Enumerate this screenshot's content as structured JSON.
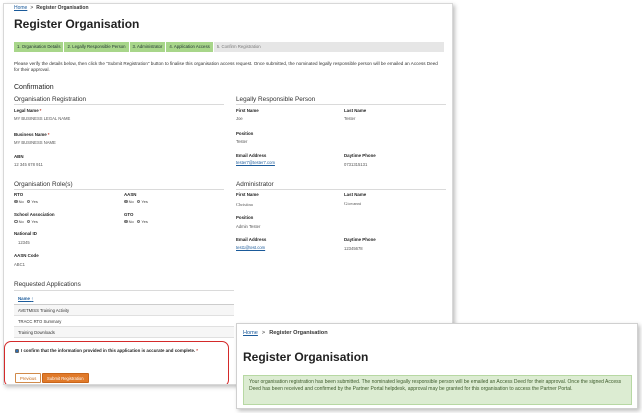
{
  "form": {
    "breadcrumb": {
      "home": "Home",
      "separator": ">",
      "current": "Register Organisation"
    },
    "title": "Register Organisation",
    "steps": [
      {
        "label": "1. Organisation Details",
        "state": "done"
      },
      {
        "label": "2. Legally Responsible Person",
        "state": "done"
      },
      {
        "label": "3. Administrator",
        "state": "done"
      },
      {
        "label": "4. Application Access",
        "state": "done"
      },
      {
        "label": "5. Confirm Registration",
        "state": "active"
      }
    ],
    "intro": "Please verify the details below, then click the \"Submit Registration\" button to finalise this organisation access request. Once submitted, the nominated legally responsible person will be emailed an Access Deed for their approval.",
    "confirmation_heading": "Confirmation",
    "org_registration": {
      "title": "Organisation Registration",
      "legal_name_label": "Legal Name",
      "legal_name_value": "MY BUSINESS LEGAL NAME",
      "business_name_label": "Business Name",
      "business_name_value": "MY BUSINESS NAME",
      "abn_label": "ABN",
      "abn_value": "12 345 678 911"
    },
    "lrp": {
      "title": "Legally Responsible Person",
      "first_name_label": "First Name",
      "first_name_value": "Joe",
      "last_name_label": "Last Name",
      "last_name_value": "Tester",
      "position_label": "Position",
      "position_value": "Tester",
      "email_label": "Email Address",
      "email_value": "tester7@tester7.com",
      "phone_label": "Daytime Phone",
      "phone_value": "0731315131"
    },
    "org_roles": {
      "title": "Organisation Role(s)",
      "rto_label": "RTO",
      "aasn_label": "AASN",
      "school_label": "School Association",
      "gto_label": "GTO",
      "no_label": "No",
      "yes_label": "Yes",
      "national_id_label": "National ID",
      "national_id_value": "12345",
      "aasn_code_label": "AASN Code",
      "aasn_code_value": "ABC1",
      "selections": {
        "rto": "no",
        "aasn": "no",
        "school": "yes",
        "gto": "no"
      }
    },
    "administrator": {
      "title": "Administrator",
      "first_name_label": "First Name",
      "first_name_value": "Christina",
      "last_name_label": "Last Name",
      "last_name_value": "Giovanni",
      "position_label": "Position",
      "position_value": "Admin Tester",
      "email_label": "Email Address",
      "email_value": "test1@test.com",
      "phone_label": "Daytime Phone",
      "phone_value": "12345678"
    },
    "requested_apps": {
      "title": "Requested Applications",
      "column_header": "Name",
      "sort_glyph": "↑",
      "rows": [
        "AVETMISS Training Activity",
        "TRACC RTO Summary",
        "Training Downloads"
      ]
    },
    "confirm": {
      "text": "I confirm that the information provided in this application is accurate and complete.",
      "required_mark": "*"
    },
    "buttons": {
      "previous": "Previous",
      "submit": "Submit Registration"
    }
  },
  "success_page": {
    "breadcrumb": {
      "home": "Home",
      "separator": ">",
      "current": "Register Organisation"
    },
    "title": "Register Organisation",
    "message": "Your organisation registration has been submitted. The nominated legally responsible person will be emailed an Access Deed for their approval. Once the signed Access Deed has been received and confirmed by the Partner Portal helpdesk, approval may be granted for this organisation to access the Partner Portal."
  },
  "colors": {
    "step_done": "#a8d68a",
    "confirm_border": "#d42a2a",
    "submit_button": "#e07a2a",
    "success_bg": "#dcecd2",
    "link": "#1a5a9a"
  }
}
